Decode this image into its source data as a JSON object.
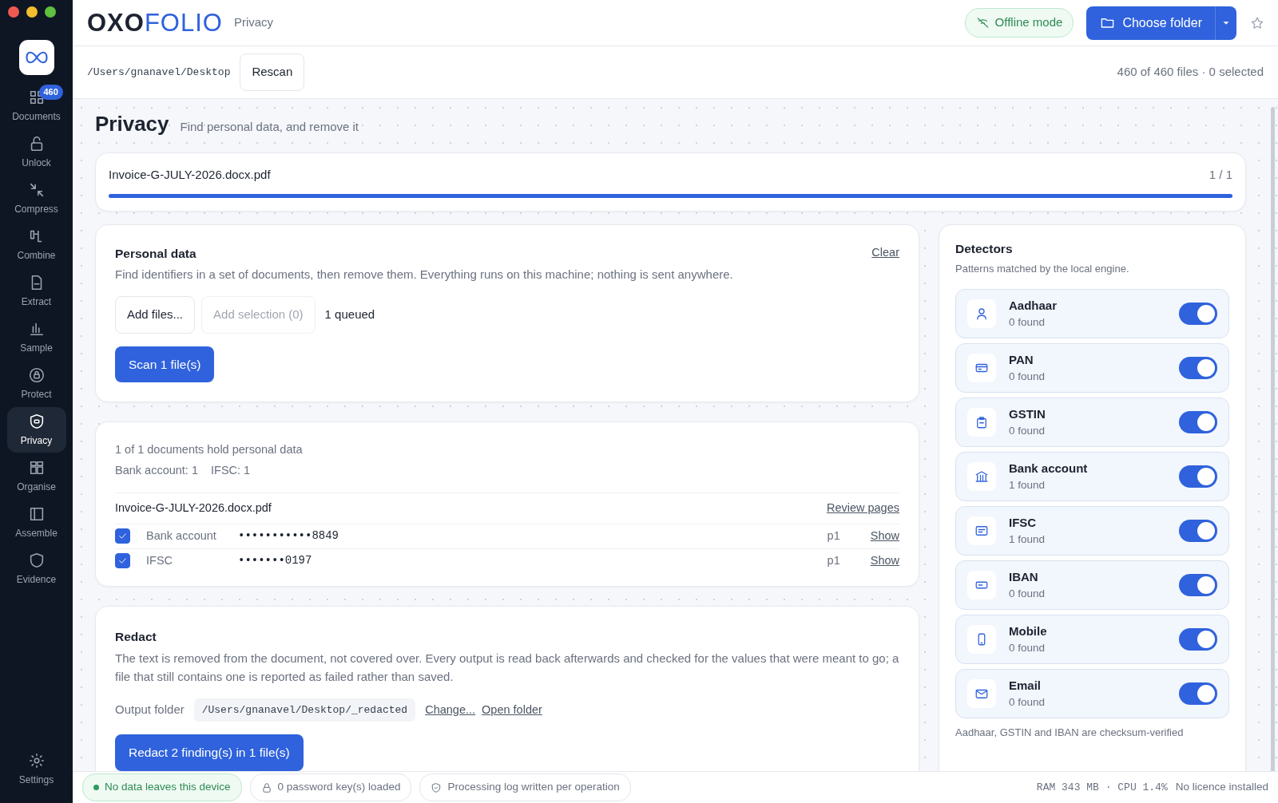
{
  "brand": {
    "dark": "OXO",
    "light": "FOLIO",
    "section": "Privacy"
  },
  "header": {
    "offline": "Offline mode",
    "choose_folder": "Choose folder"
  },
  "sidebar": {
    "items": [
      {
        "label": "Documents",
        "badge": "460",
        "selected": false
      },
      {
        "label": "Unlock",
        "selected": false
      },
      {
        "label": "Compress",
        "selected": false
      },
      {
        "label": "Combine",
        "selected": false
      },
      {
        "label": "Extract",
        "selected": false
      },
      {
        "label": "Sample",
        "selected": false
      },
      {
        "label": "Protect",
        "selected": false
      },
      {
        "label": "Privacy",
        "selected": true
      },
      {
        "label": "Organise",
        "selected": false
      },
      {
        "label": "Assemble",
        "selected": false
      },
      {
        "label": "Evidence",
        "selected": false
      }
    ],
    "settings": "Settings"
  },
  "pathbar": {
    "path": "/Users/gnanavel/Desktop",
    "rescan": "Rescan",
    "summary": "460 of 460 files · 0 selected"
  },
  "page": {
    "title": "Privacy",
    "subtitle": "Find personal data, and remove it"
  },
  "progress": {
    "file": "Invoice-G-JULY-2026.docx.pdf",
    "count": "1 / 1",
    "level": 1
  },
  "personal_data": {
    "title": "Personal data",
    "clear": "Clear",
    "description": "Find identifiers in a set of documents, then remove them. Everything runs on this machine; nothing is sent anywhere.",
    "add_files": "Add files...",
    "add_selection": {
      "label": "Add selection (0)",
      "disabled": true
    },
    "queued": "1 queued",
    "scan": "Scan 1 file(s)"
  },
  "results": {
    "summary": "1 of 1 documents hold personal data",
    "counts": [
      "Bank account: 1",
      "IFSC: 1"
    ],
    "file": "Invoice-G-JULY-2026.docx.pdf",
    "review": "Review pages",
    "findings": [
      {
        "checked": true,
        "type": "Bank account",
        "value": "•••••••••••8849",
        "page": "p1",
        "action": "Show"
      },
      {
        "checked": true,
        "type": "IFSC",
        "value": "•••••••0197",
        "page": "p1",
        "action": "Show"
      }
    ]
  },
  "redact": {
    "title": "Redact",
    "description": "The text is removed from the document, not covered over. Every output is read back afterwards and checked for the values that were meant to go; a file that still contains one is reported as failed rather than saved.",
    "output_label": "Output folder",
    "output_path": "/Users/gnanavel/Desktop/_redacted",
    "change": "Change...",
    "open": "Open folder",
    "button": "Redact 2 finding(s) in 1 file(s)"
  },
  "detectors": {
    "title": "Detectors",
    "subtitle": "Patterns matched by the local engine.",
    "items": [
      {
        "name": "Aadhaar",
        "found": "0 found",
        "on": true
      },
      {
        "name": "PAN",
        "found": "0 found",
        "on": true
      },
      {
        "name": "GSTIN",
        "found": "0 found",
        "on": true
      },
      {
        "name": "Bank account",
        "found": "1 found",
        "on": true
      },
      {
        "name": "IFSC",
        "found": "1 found",
        "on": true
      },
      {
        "name": "IBAN",
        "found": "0 found",
        "on": true
      },
      {
        "name": "Mobile",
        "found": "0 found",
        "on": true
      },
      {
        "name": "Email",
        "found": "0 found",
        "on": true
      }
    ],
    "note": "Aadhaar, GSTIN and IBAN are checksum-verified"
  },
  "status_bar": {
    "privacy": "No data leaves this device",
    "keys": "0 password key(s) loaded",
    "log": "Processing log written per operation",
    "resources": "RAM 343 MB · CPU 1.4%",
    "licence": "No licence installed"
  }
}
